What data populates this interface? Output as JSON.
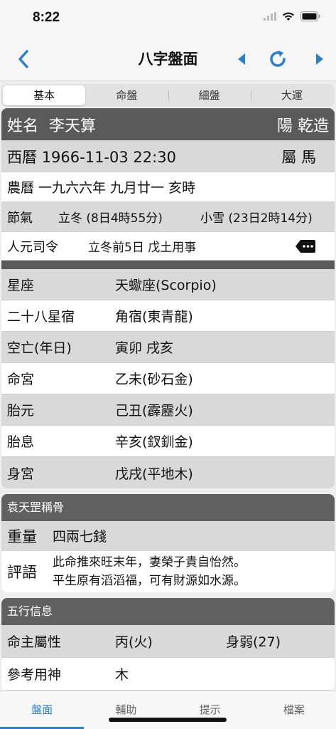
{
  "status": {
    "time": "8:22"
  },
  "nav": {
    "title": "八字盤面"
  },
  "segments": [
    "基本",
    "命盤",
    "細盤",
    "大運"
  ],
  "header": {
    "name_label": "姓名",
    "name": "李天算",
    "gender": "陽 乾造",
    "date_label": "西曆",
    "date": "1966-11-03 22:30",
    "zodiac": "屬 馬",
    "lunar_label": "農曆",
    "lunar": "一九六六年 九月廿一 亥時",
    "jieqi_label": "節氣",
    "jieqi1": "立冬 (8日4時55分)",
    "jieqi2": "小雪 (23日2時14分)",
    "renyuan_label": "人元司令",
    "renyuan": "立冬前5日 戊土用事"
  },
  "info": [
    {
      "label": "星座",
      "value": "天蠍座(Scorpio)"
    },
    {
      "label": "二十八星宿",
      "value": "角宿(東青龍)"
    },
    {
      "label": "空亡(年日)",
      "value": "寅卯 戌亥"
    },
    {
      "label": "命宮",
      "value": "乙未(砂石金)"
    },
    {
      "label": "胎元",
      "value": "己丑(霹靂火)"
    },
    {
      "label": "胎息",
      "value": "辛亥(釵釧金)"
    },
    {
      "label": "身宮",
      "value": "戊戌(平地木)"
    }
  ],
  "bone": {
    "title": "袁天罡稱骨",
    "weight_label": "重量",
    "weight": "四兩七錢",
    "comment_label": "評語",
    "comment_line1": "此命推來旺末年，妻榮子貴自怡然。",
    "comment_line2": "平生原有滔滔福，可有財源如水源。"
  },
  "wuxing": {
    "title": "五行信息",
    "rows": [
      {
        "label": "命主屬性",
        "value1": "丙(火)",
        "value2": "身弱(27)"
      },
      {
        "label": "參考用神",
        "value1": "木",
        "value2": ""
      }
    ]
  },
  "tabs": [
    "盤面",
    "輔助",
    "提示",
    "檔案"
  ],
  "colors": {
    "accent": "#2a7fd0",
    "header_gray": "#606060",
    "row_gray": "#d9d9d9"
  },
  "icons": [
    "back-chevron-icon",
    "prev-triangle-icon",
    "refresh-icon",
    "next-triangle-icon",
    "more-dots-icon",
    "wifi-icon",
    "battery-icon",
    "signal-icon"
  ]
}
